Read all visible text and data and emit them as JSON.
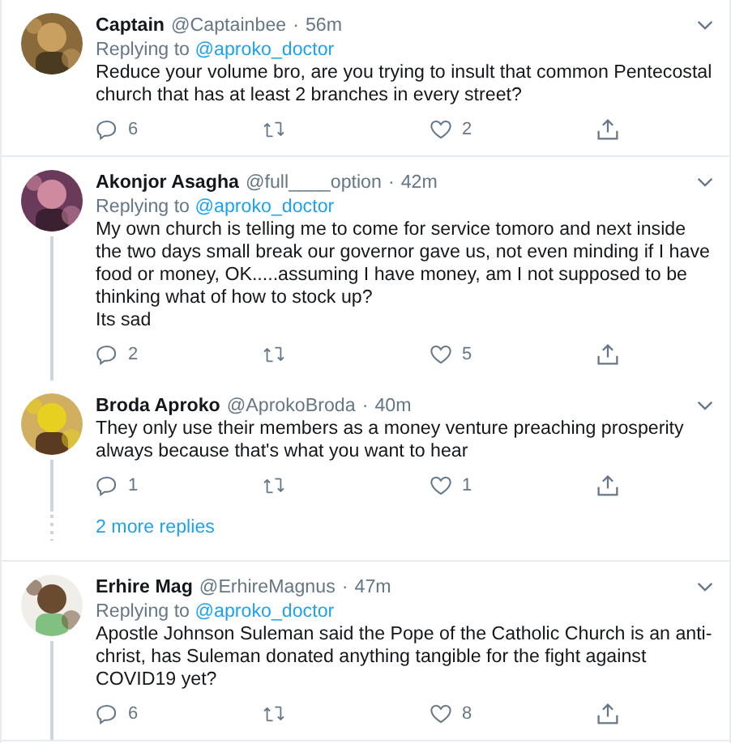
{
  "threads": [
    {
      "tweets": [
        {
          "name": "Captain",
          "handle": "@Captainbee",
          "separator": "·",
          "time": "56m",
          "replying_label": "Replying to",
          "replying_to": "@aproko_doctor",
          "text": [
            "Reduce your volume bro, are you trying to insult that common Pentecostal church that has at least 2 branches in every street?"
          ],
          "replies": "6",
          "likes": "2",
          "connected_below": false,
          "avatar": {
            "kind": "picture"
          }
        }
      ]
    },
    {
      "more_replies": "2 more replies",
      "tweets": [
        {
          "name": "Akonjor Asagha",
          "handle": "@full____option",
          "separator": "·",
          "time": "42m",
          "replying_label": "Replying to",
          "replying_to": "@aproko_doctor",
          "text": [
            "My own church is telling me to come for service tomoro and next inside the two days small break our governor gave us, not even minding if I have food or money, OK.....assuming I have money, am I not supposed to be thinking what of how to stock up?",
            "Its sad"
          ],
          "replies": "2",
          "likes": "5",
          "connected_below": true,
          "avatar": {
            "kind": "picture"
          }
        },
        {
          "name": "Broda Aproko",
          "handle": "@AprokoBroda",
          "separator": "·",
          "time": "40m",
          "text": [
            "They only use their members as a money venture preaching prosperity always because that's what you want to hear"
          ],
          "replies": "1",
          "likes": "1",
          "connected_below": true,
          "avatar": {
            "kind": "picture"
          }
        }
      ]
    },
    {
      "tweets": [
        {
          "name": "Erhire Mag",
          "handle": "@ErhireMagnus",
          "separator": "·",
          "time": "47m",
          "replying_label": "Replying to",
          "replying_to": "@aproko_doctor",
          "text": [
            "Apostle Johnson Suleman said the Pope of the Catholic Church is an anti-christ, has Suleman donated anything tangible for the fight against COVID19 yet?"
          ],
          "replies": "6",
          "likes": "8",
          "connected_below": true,
          "avatar": {
            "kind": "picture"
          }
        }
      ]
    }
  ]
}
